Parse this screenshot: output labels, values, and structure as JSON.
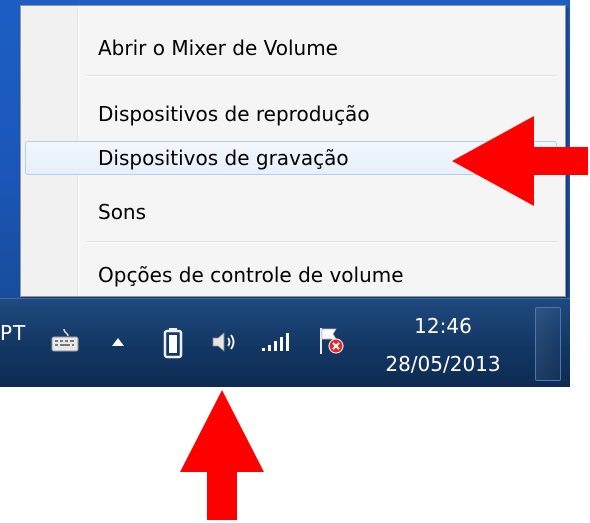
{
  "context_menu": {
    "items": [
      {
        "label": "Abrir o Mixer de Volume"
      },
      {
        "label": "Dispositivos de reprodução"
      },
      {
        "label": "Dispositivos de gravação"
      },
      {
        "label": "Sons"
      },
      {
        "label": "Opções de controle de volume"
      }
    ],
    "highlighted_item": "Dispositivos de gravação"
  },
  "taskbar": {
    "language": "PT",
    "clock": {
      "time": "12:46",
      "date": "28/05/2013"
    },
    "tray_icons": [
      "keyboard-icon",
      "show-hidden-icons-icon",
      "battery-icon",
      "speaker-icon",
      "network-signal-icon",
      "action-center-flag-icon"
    ]
  },
  "annotations": {
    "arrow_color": "#ff0000",
    "arrows": [
      "arrow-pointing-left",
      "arrow-pointing-up"
    ]
  },
  "colors": {
    "taskbar": "#133865",
    "menu_background": "#f5f5f5",
    "highlight_border": "#aecff7"
  }
}
